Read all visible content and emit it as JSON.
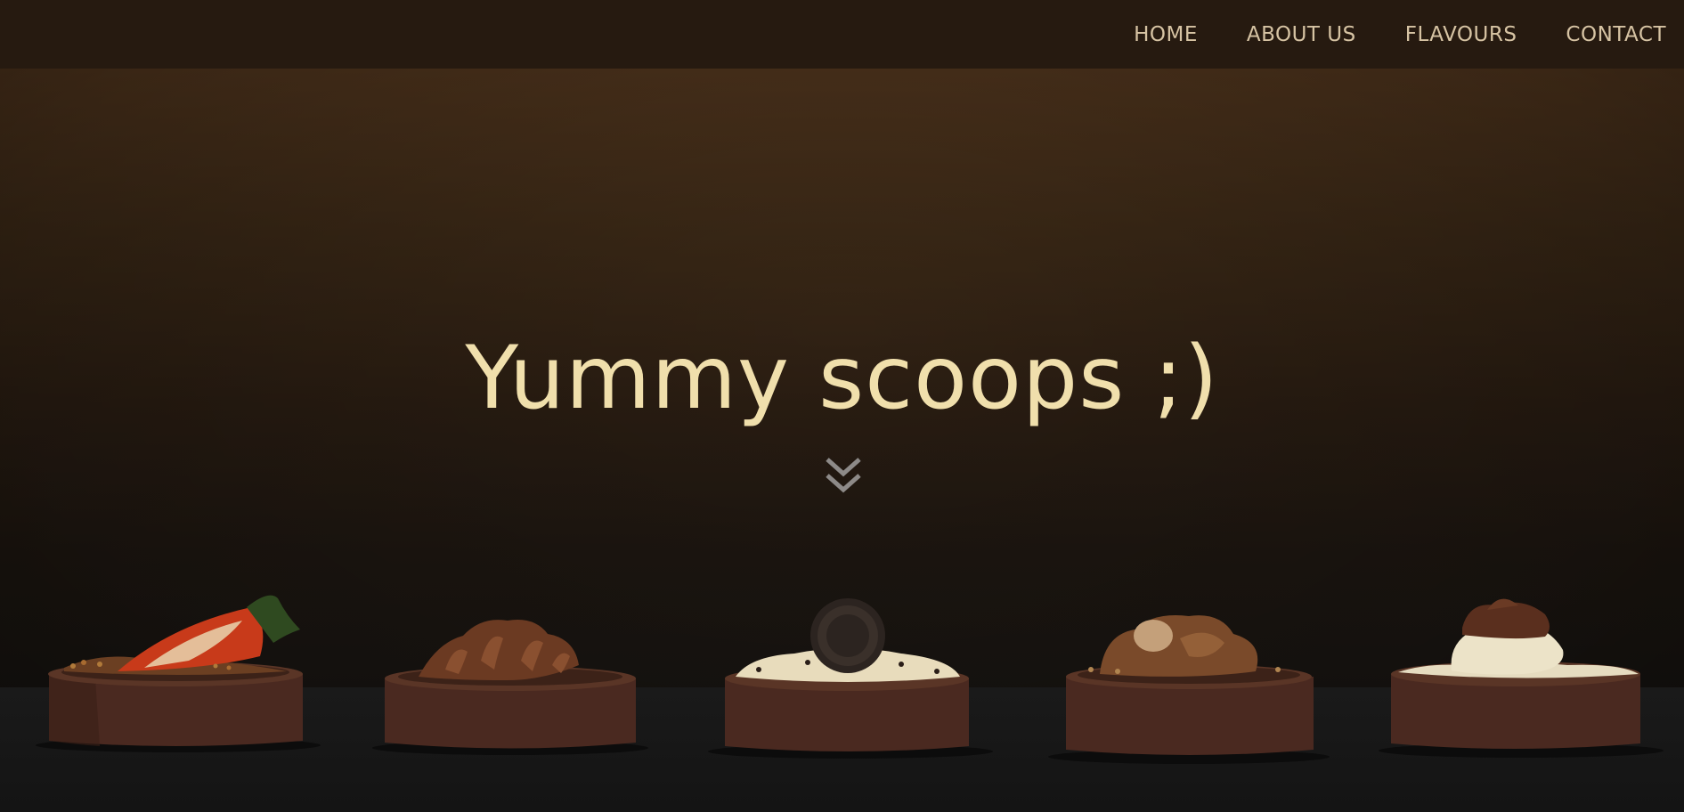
{
  "nav": {
    "items": [
      {
        "label": "HOME"
      },
      {
        "label": "ABOUT US"
      },
      {
        "label": "FLAVOURS"
      },
      {
        "label": "CONTACT"
      }
    ]
  },
  "hero": {
    "title": "Yummy scoops ;)",
    "scroll_icon": "double-chevron-down-icon"
  },
  "colors": {
    "navbar_bg": "#261a10",
    "nav_text": "#d6c3a3",
    "title_text": "#f0dfac",
    "chocolate_cup": "#4a2a1f"
  }
}
